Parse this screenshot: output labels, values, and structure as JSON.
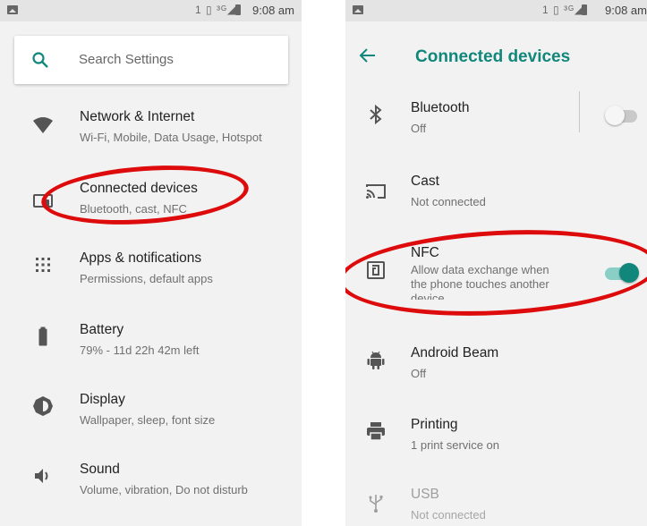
{
  "colors": {
    "accent": "#11877b",
    "annotation": "#dd0b0b",
    "background": "#f2f2f2"
  },
  "statusbar": {
    "time": "9:08 am",
    "icons": "1 ▯ ³ᴳ◢"
  },
  "left": {
    "search_placeholder": "Search Settings",
    "items": [
      {
        "title": "Network & Internet",
        "subtitle": "Wi-Fi, Mobile, Data Usage, Hotspot",
        "icon": "wifi-icon"
      },
      {
        "title": "Connected devices",
        "subtitle": "Bluetooth, cast, NFC",
        "icon": "connected-devices-icon"
      },
      {
        "title": "Apps & notifications",
        "subtitle": "Permissions, default apps",
        "icon": "apps-grid-icon"
      },
      {
        "title": "Battery",
        "subtitle": "79% - 11d 22h 42m left",
        "icon": "battery-icon"
      },
      {
        "title": "Display",
        "subtitle": "Wallpaper, sleep, font size",
        "icon": "brightness-icon"
      },
      {
        "title": "Sound",
        "subtitle": "Volume, vibration, Do not disturb",
        "icon": "speaker-icon"
      }
    ]
  },
  "right": {
    "title": "Connected devices",
    "items": [
      {
        "title": "Bluetooth",
        "subtitle": "Off",
        "icon": "bluetooth-icon",
        "toggle": "off"
      },
      {
        "title": "Cast",
        "subtitle": "Not connected",
        "icon": "cast-icon"
      },
      {
        "title": "NFC",
        "subtitle_lines": [
          "Allow data exchange when",
          "the phone touches another",
          "device"
        ],
        "icon": "nfc-icon",
        "toggle": "on"
      },
      {
        "title": "Android Beam",
        "subtitle": "Off",
        "icon": "android-icon"
      },
      {
        "title": "Printing",
        "subtitle": "1 print service on",
        "icon": "printer-icon"
      },
      {
        "title": "USB",
        "subtitle": "Not connected",
        "icon": "usb-icon",
        "disabled": true
      }
    ]
  }
}
